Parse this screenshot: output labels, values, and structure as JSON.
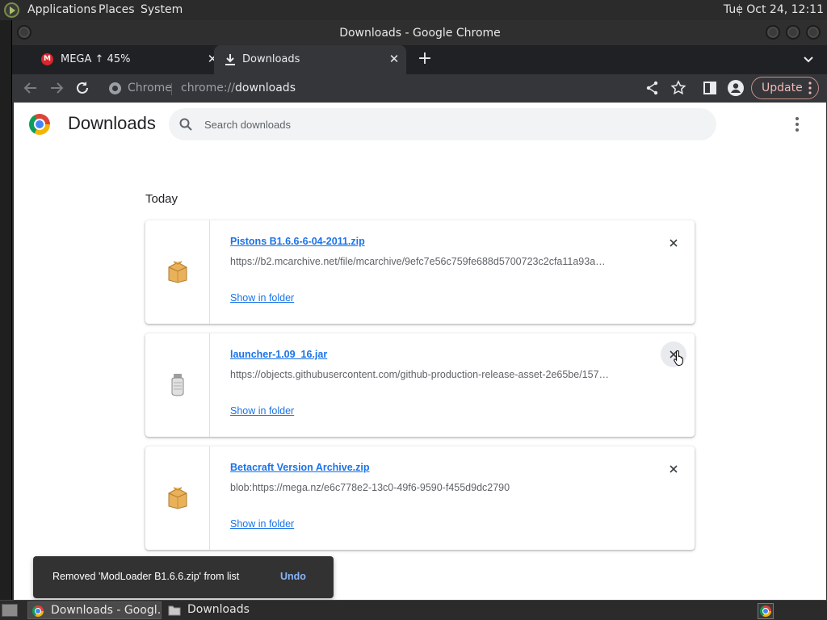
{
  "top_panel": {
    "menus": [
      "Applications",
      "Places",
      "System"
    ],
    "clock": "Tue Oct 24, 12:11"
  },
  "window": {
    "title": "Downloads - Google Chrome"
  },
  "tabs": [
    {
      "label": "MEGA ↑ 45%",
      "icon": "mega-icon",
      "upload_progress_percent": 45
    },
    {
      "label": "Downloads",
      "icon": "download-icon",
      "active": true
    }
  ],
  "toolbar": {
    "chip": "Chrome",
    "url_scheme": "chrome://",
    "url_path": "downloads",
    "update_label": "Update"
  },
  "page": {
    "title": "Downloads",
    "search_placeholder": "Search downloads",
    "date_header": "Today",
    "downloads": [
      {
        "file_name": "Pistons B1.6.6-6-04-2011.zip",
        "url": "https://b2.mcarchive.net/file/mcarchive/9efc7e56c759fe688d5700723c2cfa11a93a…",
        "action": "Show in folder",
        "icon": "zip-archive-icon"
      },
      {
        "file_name": "launcher-1.09_16.jar",
        "url": "https://objects.githubusercontent.com/github-production-release-asset-2e65be/157…",
        "action": "Show in folder",
        "icon": "jar-file-icon"
      },
      {
        "file_name": "Betacraft Version Archive.zip",
        "url": "blob:https://mega.nz/e6c778e2-13c0-49f6-9590-f455d9dc2790",
        "action": "Show in folder",
        "icon": "zip-archive-icon"
      }
    ],
    "toast": {
      "message": "Removed 'ModLoader B1.6.6.zip' from list",
      "action": "Undo"
    }
  },
  "taskbar": {
    "tasks": [
      "Downloads - Googl…",
      "Downloads"
    ]
  },
  "colors": {
    "link": "#1a73e8",
    "toast_bg": "#323232",
    "update_accent": "#f2b8b5"
  }
}
